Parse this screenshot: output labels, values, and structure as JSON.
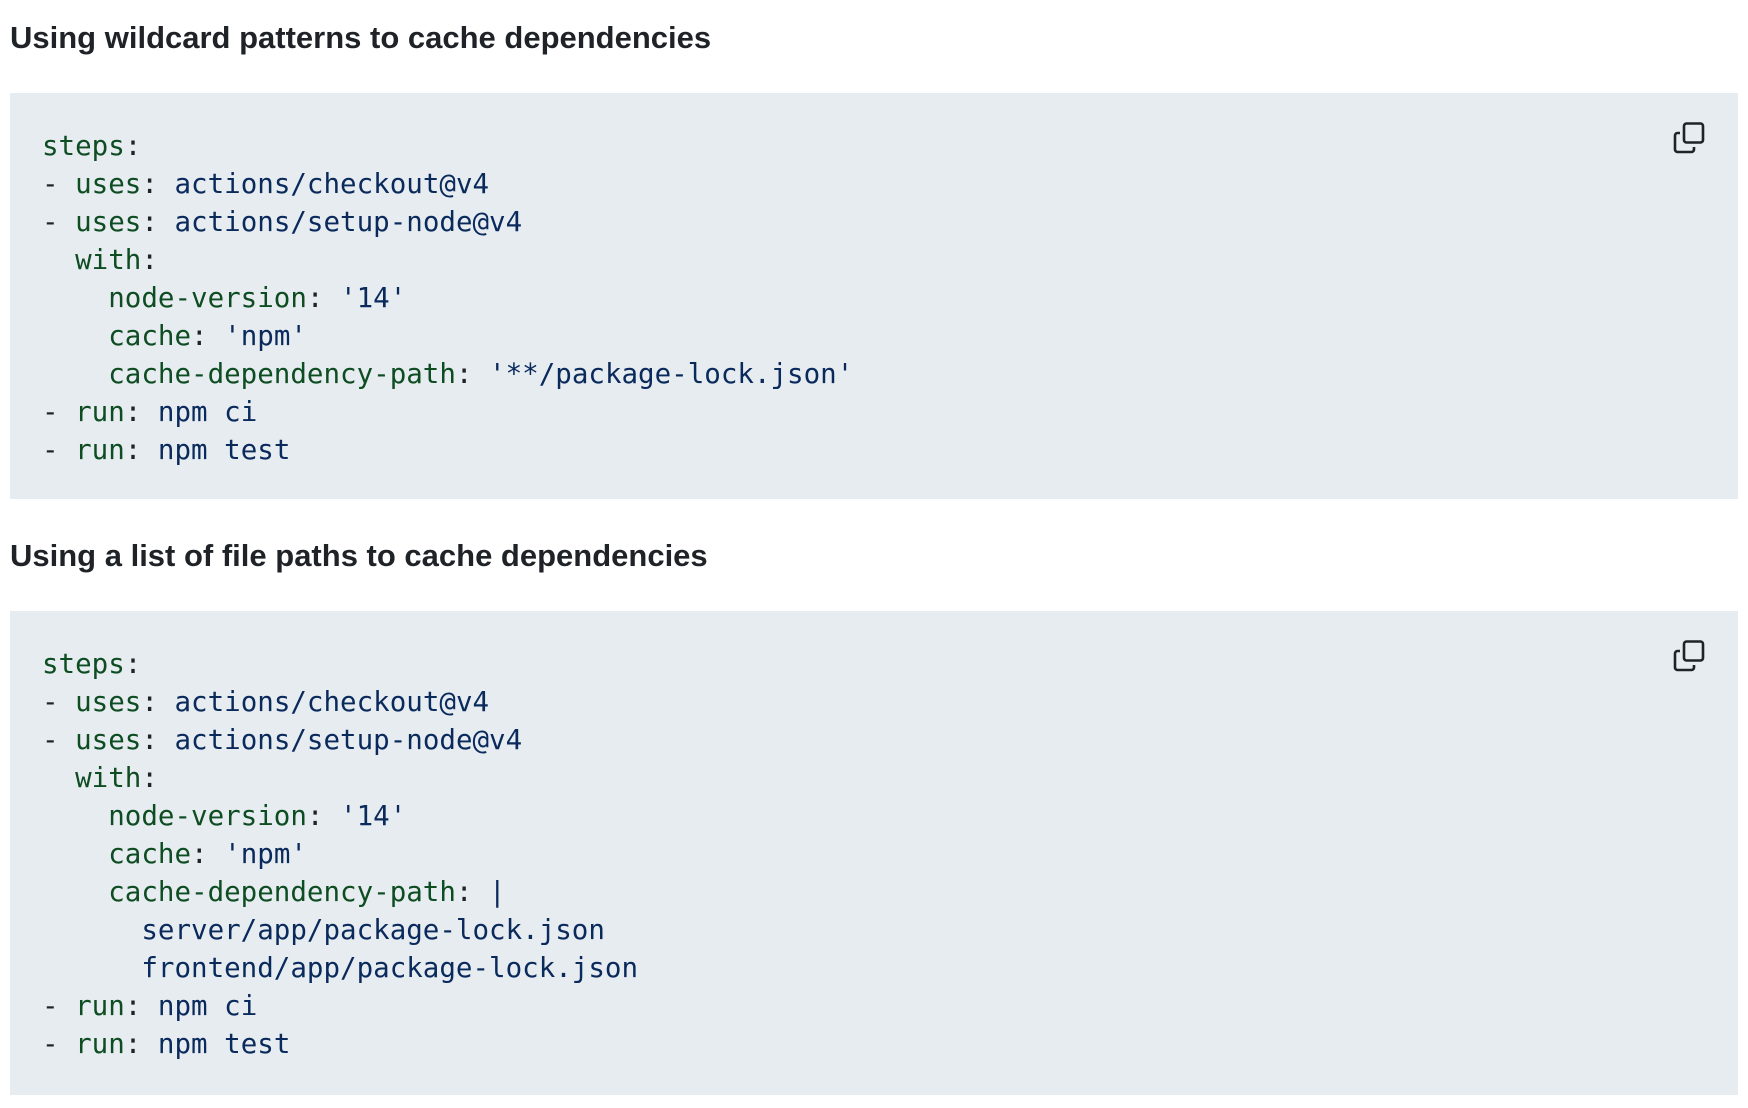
{
  "sections": [
    {
      "heading": "Using wildcard patterns to cache dependencies",
      "copy_icon": "copy-icon",
      "code_lines": [
        [
          {
            "t": "key",
            "v": "steps"
          },
          {
            "t": "punc",
            "v": ":"
          }
        ],
        [
          {
            "t": "dash",
            "v": "- "
          },
          {
            "t": "key",
            "v": "uses"
          },
          {
            "t": "punc",
            "v": ": "
          },
          {
            "t": "val",
            "v": "actions/checkout@v4"
          }
        ],
        [
          {
            "t": "dash",
            "v": "- "
          },
          {
            "t": "key",
            "v": "uses"
          },
          {
            "t": "punc",
            "v": ": "
          },
          {
            "t": "val",
            "v": "actions/setup-node@v4"
          }
        ],
        [
          {
            "t": "dash",
            "v": "  "
          },
          {
            "t": "key",
            "v": "with"
          },
          {
            "t": "punc",
            "v": ":"
          }
        ],
        [
          {
            "t": "dash",
            "v": "    "
          },
          {
            "t": "key",
            "v": "node-version"
          },
          {
            "t": "punc",
            "v": ": "
          },
          {
            "t": "val",
            "v": "'14'"
          }
        ],
        [
          {
            "t": "dash",
            "v": "    "
          },
          {
            "t": "key",
            "v": "cache"
          },
          {
            "t": "punc",
            "v": ": "
          },
          {
            "t": "val",
            "v": "'npm'"
          }
        ],
        [
          {
            "t": "dash",
            "v": "    "
          },
          {
            "t": "key",
            "v": "cache-dependency-path"
          },
          {
            "t": "punc",
            "v": ": "
          },
          {
            "t": "val",
            "v": "'**/package-lock.json'"
          }
        ],
        [
          {
            "t": "dash",
            "v": "- "
          },
          {
            "t": "key",
            "v": "run"
          },
          {
            "t": "punc",
            "v": ": "
          },
          {
            "t": "val",
            "v": "npm ci"
          }
        ],
        [
          {
            "t": "dash",
            "v": "- "
          },
          {
            "t": "key",
            "v": "run"
          },
          {
            "t": "punc",
            "v": ": "
          },
          {
            "t": "val",
            "v": "npm test"
          }
        ]
      ]
    },
    {
      "heading": "Using a list of file paths to cache dependencies",
      "copy_icon": "copy-icon",
      "code_lines": [
        [
          {
            "t": "key",
            "v": "steps"
          },
          {
            "t": "punc",
            "v": ":"
          }
        ],
        [
          {
            "t": "dash",
            "v": "- "
          },
          {
            "t": "key",
            "v": "uses"
          },
          {
            "t": "punc",
            "v": ": "
          },
          {
            "t": "val",
            "v": "actions/checkout@v4"
          }
        ],
        [
          {
            "t": "dash",
            "v": "- "
          },
          {
            "t": "key",
            "v": "uses"
          },
          {
            "t": "punc",
            "v": ": "
          },
          {
            "t": "val",
            "v": "actions/setup-node@v4"
          }
        ],
        [
          {
            "t": "dash",
            "v": "  "
          },
          {
            "t": "key",
            "v": "with"
          },
          {
            "t": "punc",
            "v": ":"
          }
        ],
        [
          {
            "t": "dash",
            "v": "    "
          },
          {
            "t": "key",
            "v": "node-version"
          },
          {
            "t": "punc",
            "v": ": "
          },
          {
            "t": "val",
            "v": "'14'"
          }
        ],
        [
          {
            "t": "dash",
            "v": "    "
          },
          {
            "t": "key",
            "v": "cache"
          },
          {
            "t": "punc",
            "v": ": "
          },
          {
            "t": "val",
            "v": "'npm'"
          }
        ],
        [
          {
            "t": "dash",
            "v": "    "
          },
          {
            "t": "key",
            "v": "cache-dependency-path"
          },
          {
            "t": "punc",
            "v": ": "
          },
          {
            "t": "val",
            "v": "|"
          }
        ],
        [
          {
            "t": "dash",
            "v": "      "
          },
          {
            "t": "val",
            "v": "server/app/package-lock.json"
          }
        ],
        [
          {
            "t": "dash",
            "v": "      "
          },
          {
            "t": "val",
            "v": "frontend/app/package-lock.json"
          }
        ],
        [
          {
            "t": "dash",
            "v": "- "
          },
          {
            "t": "key",
            "v": "run"
          },
          {
            "t": "punc",
            "v": ": "
          },
          {
            "t": "val",
            "v": "npm ci"
          }
        ],
        [
          {
            "t": "dash",
            "v": "- "
          },
          {
            "t": "key",
            "v": "run"
          },
          {
            "t": "punc",
            "v": ": "
          },
          {
            "t": "val",
            "v": "npm test"
          }
        ]
      ]
    }
  ],
  "colors": {
    "code_background": "#e7ecf1",
    "yaml_key": "#0e4d22",
    "yaml_value": "#0a2a5c",
    "heading_text": "#1f2328"
  }
}
